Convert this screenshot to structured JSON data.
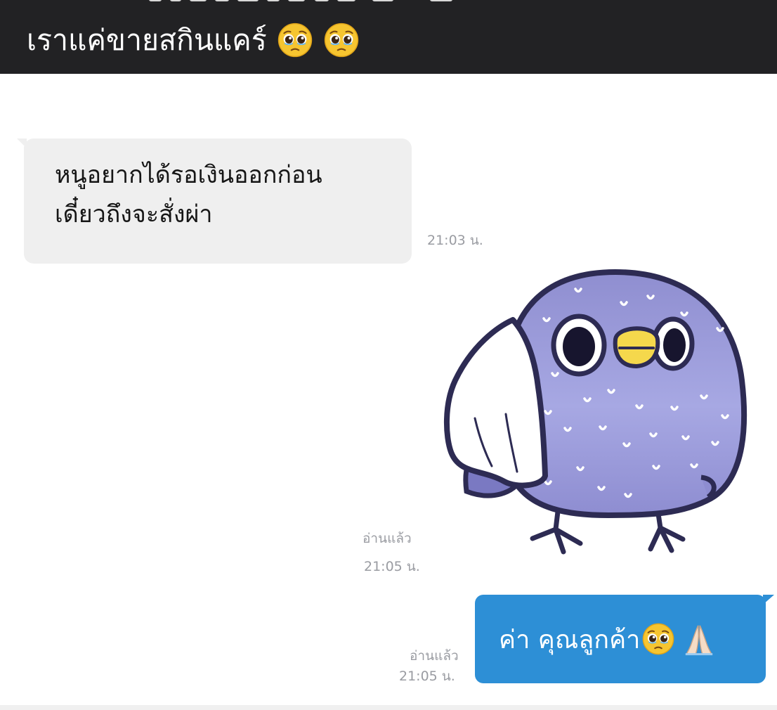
{
  "caption": {
    "text": "เราแค่ขายสกินแคร์",
    "emojis": [
      "pleading-face-emoji",
      "pleading-face-emoji"
    ]
  },
  "chat": {
    "incoming_message": {
      "lines": [
        "หนูอยากได้รอเงินออกก่อน",
        "เดี๋ยวถึงจะสั่งผ่า"
      ],
      "time": "21:03 น."
    },
    "sticker_message": {
      "sticker": "crying-purple-bird-sticker",
      "read_status": "อ่านแล้ว",
      "time": "21:05 น."
    },
    "outgoing_message": {
      "text": "ค่า คุณลูกค้า",
      "emojis": [
        "pleading-face-emoji",
        "folded-hands-emoji"
      ],
      "read_status": "อ่านแล้ว",
      "time": "21:05 น."
    }
  },
  "colors": {
    "caption_background": "#222224",
    "incoming_bubble": "#efefef",
    "outgoing_bubble": "#2d8fd6",
    "meta_text": "#9a9ca2",
    "sticker_body": "#8f8ed0"
  }
}
